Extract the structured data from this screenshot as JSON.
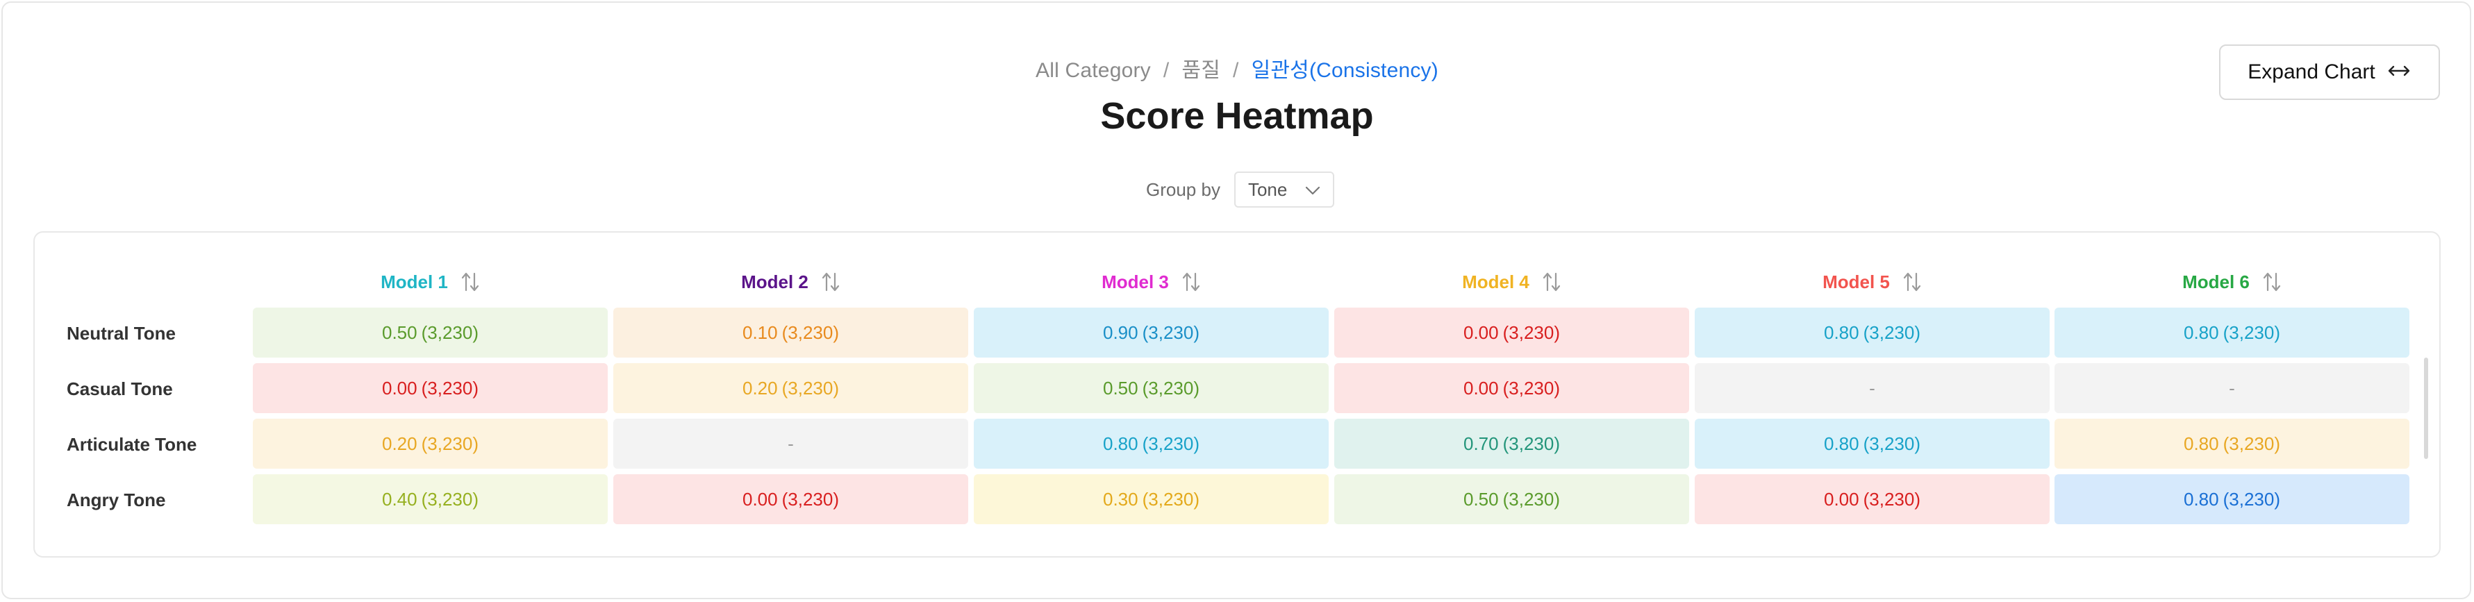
{
  "breadcrumb": {
    "items": [
      "All Category",
      "품질"
    ],
    "current": "일관성(Consistency)",
    "separator": "/"
  },
  "page_title": "Score Heatmap",
  "group_by": {
    "label": "Group by",
    "value": "Tone"
  },
  "expand_button": {
    "label": "Expand Chart",
    "icon": "horizontal-arrows-icon"
  },
  "models": [
    {
      "name": "Model 1",
      "color": "#1fb5c5"
    },
    {
      "name": "Model 2",
      "color": "#5b148a"
    },
    {
      "name": "Model 3",
      "color": "#e02bd0"
    },
    {
      "name": "Model 4",
      "color": "#f0b323"
    },
    {
      "name": "Model 5",
      "color": "#f2544e"
    },
    {
      "name": "Model 6",
      "color": "#27a844"
    }
  ],
  "rows": [
    {
      "label": "Neutral Tone",
      "cells": [
        {
          "score": "0.50",
          "count": "(3,230)",
          "bg": "#eef6e6",
          "fg": "#5a9b2c"
        },
        {
          "score": "0.10",
          "count": "(3,230)",
          "bg": "#fcf0e0",
          "fg": "#e88a1d"
        },
        {
          "score": "0.90",
          "count": "(3,230)",
          "bg": "#d9f1fa",
          "fg": "#1a8fc7"
        },
        {
          "score": "0.00",
          "count": "(3,230)",
          "bg": "#fde4e4",
          "fg": "#d81f1f"
        },
        {
          "score": "0.80",
          "count": "(3,230)",
          "bg": "#d9f1fa",
          "fg": "#18a2c8"
        },
        {
          "score": "0.80",
          "count": "(3,230)",
          "bg": "#d9f1fa",
          "fg": "#18a2c8"
        }
      ]
    },
    {
      "label": "Casual Tone",
      "cells": [
        {
          "score": "0.00",
          "count": "(3,230)",
          "bg": "#fde4e4",
          "fg": "#d81f1f"
        },
        {
          "score": "0.20",
          "count": "(3,230)",
          "bg": "#fdf3df",
          "fg": "#e8a723"
        },
        {
          "score": "0.50",
          "count": "(3,230)",
          "bg": "#eef6e6",
          "fg": "#5a9b2c"
        },
        {
          "score": "0.00",
          "count": "(3,230)",
          "bg": "#fde4e4",
          "fg": "#d81f1f"
        },
        {
          "score": "-",
          "count": "",
          "bg": "#f3f3f3",
          "fg": "#9a9a9a"
        },
        {
          "score": "-",
          "count": "",
          "bg": "#f3f3f3",
          "fg": "#9a9a9a"
        }
      ]
    },
    {
      "label": "Articulate Tone",
      "cells": [
        {
          "score": "0.20",
          "count": "(3,230)",
          "bg": "#fdf3df",
          "fg": "#e8a723"
        },
        {
          "score": "-",
          "count": "",
          "bg": "#f3f3f3",
          "fg": "#9a9a9a"
        },
        {
          "score": "0.80",
          "count": "(3,230)",
          "bg": "#d9f1fa",
          "fg": "#18a2c8"
        },
        {
          "score": "0.70",
          "count": "(3,230)",
          "bg": "#e0f2ee",
          "fg": "#23957a"
        },
        {
          "score": "0.80",
          "count": "(3,230)",
          "bg": "#d9f1fa",
          "fg": "#18a2c8"
        },
        {
          "score": "0.80",
          "count": "(3,230)",
          "bg": "#fdf3df",
          "fg": "#e8a723"
        }
      ]
    },
    {
      "label": "Angry Tone",
      "cells": [
        {
          "score": "0.40",
          "count": "(3,230)",
          "bg": "#f4f8e3",
          "fg": "#96b020"
        },
        {
          "score": "0.00",
          "count": "(3,230)",
          "bg": "#fde4e4",
          "fg": "#d81f1f"
        },
        {
          "score": "0.30",
          "count": "(3,230)",
          "bg": "#fdf7d8",
          "fg": "#e3a91b"
        },
        {
          "score": "0.50",
          "count": "(3,230)",
          "bg": "#eef6e6",
          "fg": "#5a9b2c"
        },
        {
          "score": "0.00",
          "count": "(3,230)",
          "bg": "#fde4e4",
          "fg": "#d81f1f"
        },
        {
          "score": "0.80",
          "count": "(3,230)",
          "bg": "#d6e9fc",
          "fg": "#1a6fd4"
        }
      ]
    }
  ]
}
